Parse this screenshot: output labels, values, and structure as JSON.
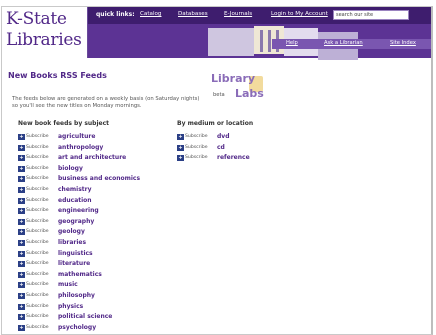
{
  "header": {
    "brand_line1": "K-State",
    "brand_line2": "Libraries",
    "quick_links_label": "quick links:",
    "quick_links": [
      "Catalog",
      "Databases",
      "E-Journals",
      "Login to My Account"
    ],
    "search_placeholder": "search our site",
    "nav": [
      "Help",
      "Ask a Librarian",
      "Site Index"
    ]
  },
  "page": {
    "title": "New Books RSS Feeds",
    "intro_line1": "The feeds below are generated on a weekly basis (on Saturday nights)",
    "intro_line2": "so you'll see the new titles on Monday mornings.",
    "logo_word1": "Library",
    "logo_word2": "Labs",
    "logo_beta": "beta"
  },
  "subject": {
    "heading": "New book feeds by subject",
    "subscribe_label": "Subscribe",
    "topics": [
      "agriculture",
      "anthropology",
      "art and architecture",
      "biology",
      "business and economics",
      "chemistry",
      "education",
      "engineering",
      "geography",
      "geology",
      "libraries",
      "linguistics",
      "literature",
      "mathematics",
      "music",
      "philosophy",
      "physics",
      "political science",
      "psychology"
    ]
  },
  "medium": {
    "heading": "By medium or location",
    "subscribe_label": "Subscribe",
    "topics": [
      "dvd",
      "cd",
      "reference"
    ]
  },
  "colors": {
    "purple": "#512888",
    "rss_icon": "#2b3f86"
  }
}
